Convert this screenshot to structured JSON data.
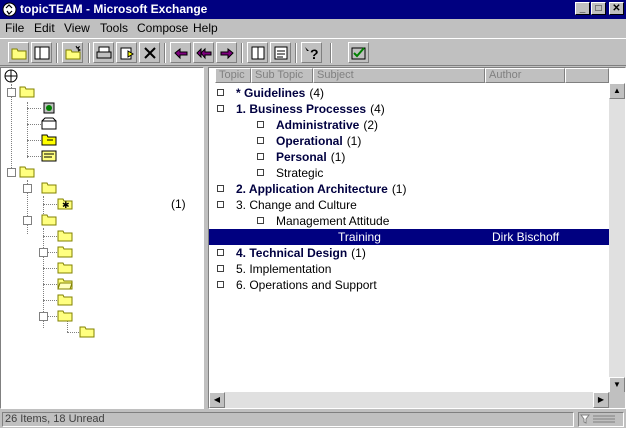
{
  "window": {
    "title": "topicTEAM - Microsoft Exchange"
  },
  "menu": [
    "File",
    "Edit",
    "View",
    "Tools",
    "Compose",
    "Help"
  ],
  "columns": [
    "Topic",
    "Sub Topic",
    "Subject",
    "Author"
  ],
  "rows": [
    {
      "text": "* Guidelines",
      "count": "(4)",
      "bold": true,
      "indent": 0
    },
    {
      "text": "1. Business Processes",
      "count": "(4)",
      "bold": true,
      "indent": 0
    },
    {
      "text": "Administrative",
      "count": "(2)",
      "bold": true,
      "indent": 1
    },
    {
      "text": "Operational",
      "count": "(1)",
      "bold": true,
      "indent": 1
    },
    {
      "text": "Personal",
      "count": "(1)",
      "bold": true,
      "indent": 1
    },
    {
      "text": "Strategic",
      "count": "",
      "bold": false,
      "indent": 1
    },
    {
      "text": "2. Application Architecture",
      "count": "(1)",
      "bold": true,
      "indent": 0
    },
    {
      "text": "3. Change and Culture",
      "count": "",
      "bold": false,
      "indent": 0
    },
    {
      "text": "Management Attitude",
      "count": "",
      "bold": false,
      "indent": 1
    },
    {
      "subject": "Training",
      "author": "Dirk Bischoff"
    },
    {
      "text": "4. Technical Design",
      "count": "(1)",
      "bold": true,
      "indent": 0
    },
    {
      "text": "5. Implementation",
      "count": "",
      "bold": false,
      "indent": 0
    },
    {
      "text": "6. Operations and Support",
      "count": "",
      "bold": false,
      "indent": 0
    }
  ],
  "tree": {
    "unread_count": "(1)"
  },
  "status": {
    "text": "26 Items, 18 Unread"
  },
  "icons": [
    "folder-icon",
    "move-icon",
    "print-icon",
    "delete-icon",
    "reply-icon",
    "reply-all-icon",
    "forward-icon",
    "address-book-icon",
    "inbox-icon",
    "help-icon",
    "checkmark-icon"
  ]
}
